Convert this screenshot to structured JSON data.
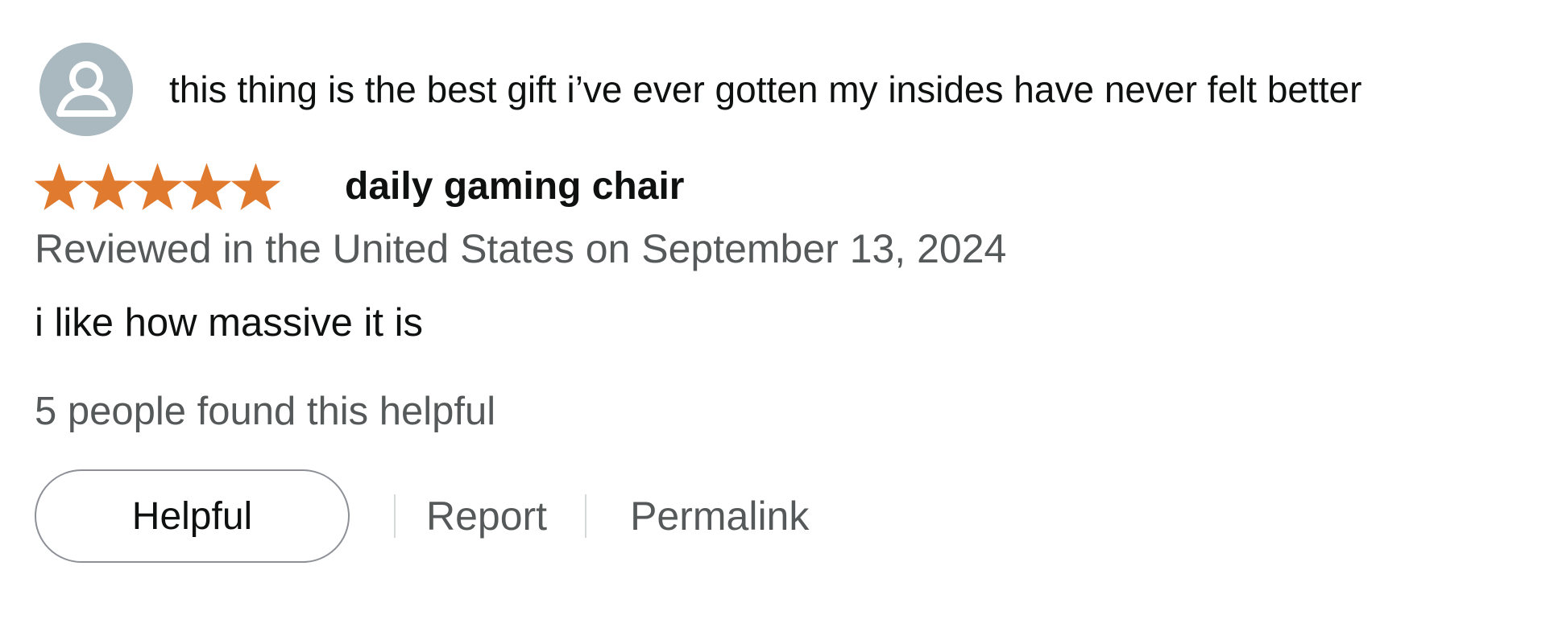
{
  "review": {
    "profile_name": "this thing is the best gift i’ve ever gotten my insides have never felt better",
    "rating": 5,
    "rating_max": 5,
    "star_color": "#e07a2e",
    "avatar_icon": "default-profile-avatar",
    "title": "daily gaming chair",
    "date": "Reviewed in the United States on September 13, 2024",
    "body": "i like how massive it is",
    "helpful_count_text": "5 people found this helpful"
  },
  "actions": {
    "helpful_label": "Helpful",
    "report_label": "Report",
    "permalink_label": "Permalink"
  },
  "colors": {
    "text_primary": "#0f1111",
    "text_secondary": "#565959",
    "avatar_background": "#aab8bf",
    "divider": "#d5d9d9"
  }
}
